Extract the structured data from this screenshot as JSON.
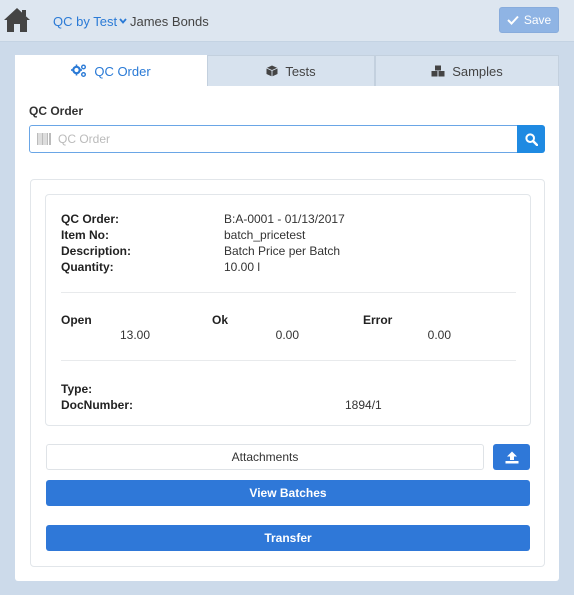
{
  "topbar": {
    "home_icon": "home-icon",
    "mode_label": "QC by Test",
    "user_name": "James Bonds",
    "save_label": "Save"
  },
  "tabs": [
    {
      "label": "QC Order",
      "icon": "gears-icon",
      "active": true
    },
    {
      "label": "Tests",
      "icon": "cube-icon",
      "active": false
    },
    {
      "label": "Samples",
      "icon": "cubes-icon",
      "active": false
    }
  ],
  "search": {
    "label": "QC Order",
    "placeholder": "QC Order",
    "value": ""
  },
  "order": {
    "qc_order_label": "QC Order:",
    "qc_order_value": "B:A-0001 - 01/13/2017",
    "item_no_label": "Item No:",
    "item_no_value": "batch_pricetest",
    "description_label": "Description:",
    "description_value": "Batch Price per Batch",
    "quantity_label": "Quantity:",
    "quantity_value": "10.00 l"
  },
  "stats": {
    "open_label": "Open",
    "open_value": "13.00",
    "ok_label": "Ok",
    "ok_value": "0.00",
    "error_label": "Error",
    "error_value": "0.00"
  },
  "doc": {
    "type_label": "Type:",
    "type_value": "",
    "docnumber_label": "DocNumber:",
    "docnumber_value": "1894/1"
  },
  "actions": {
    "attachments_label": "Attachments",
    "view_batches_label": "View Batches",
    "transfer_label": "Transfer"
  },
  "colors": {
    "accent": "#2f78d8",
    "search_button": "#1f8ae2",
    "save_disabled": "#8fb4e4",
    "background": "#ccdaea"
  }
}
